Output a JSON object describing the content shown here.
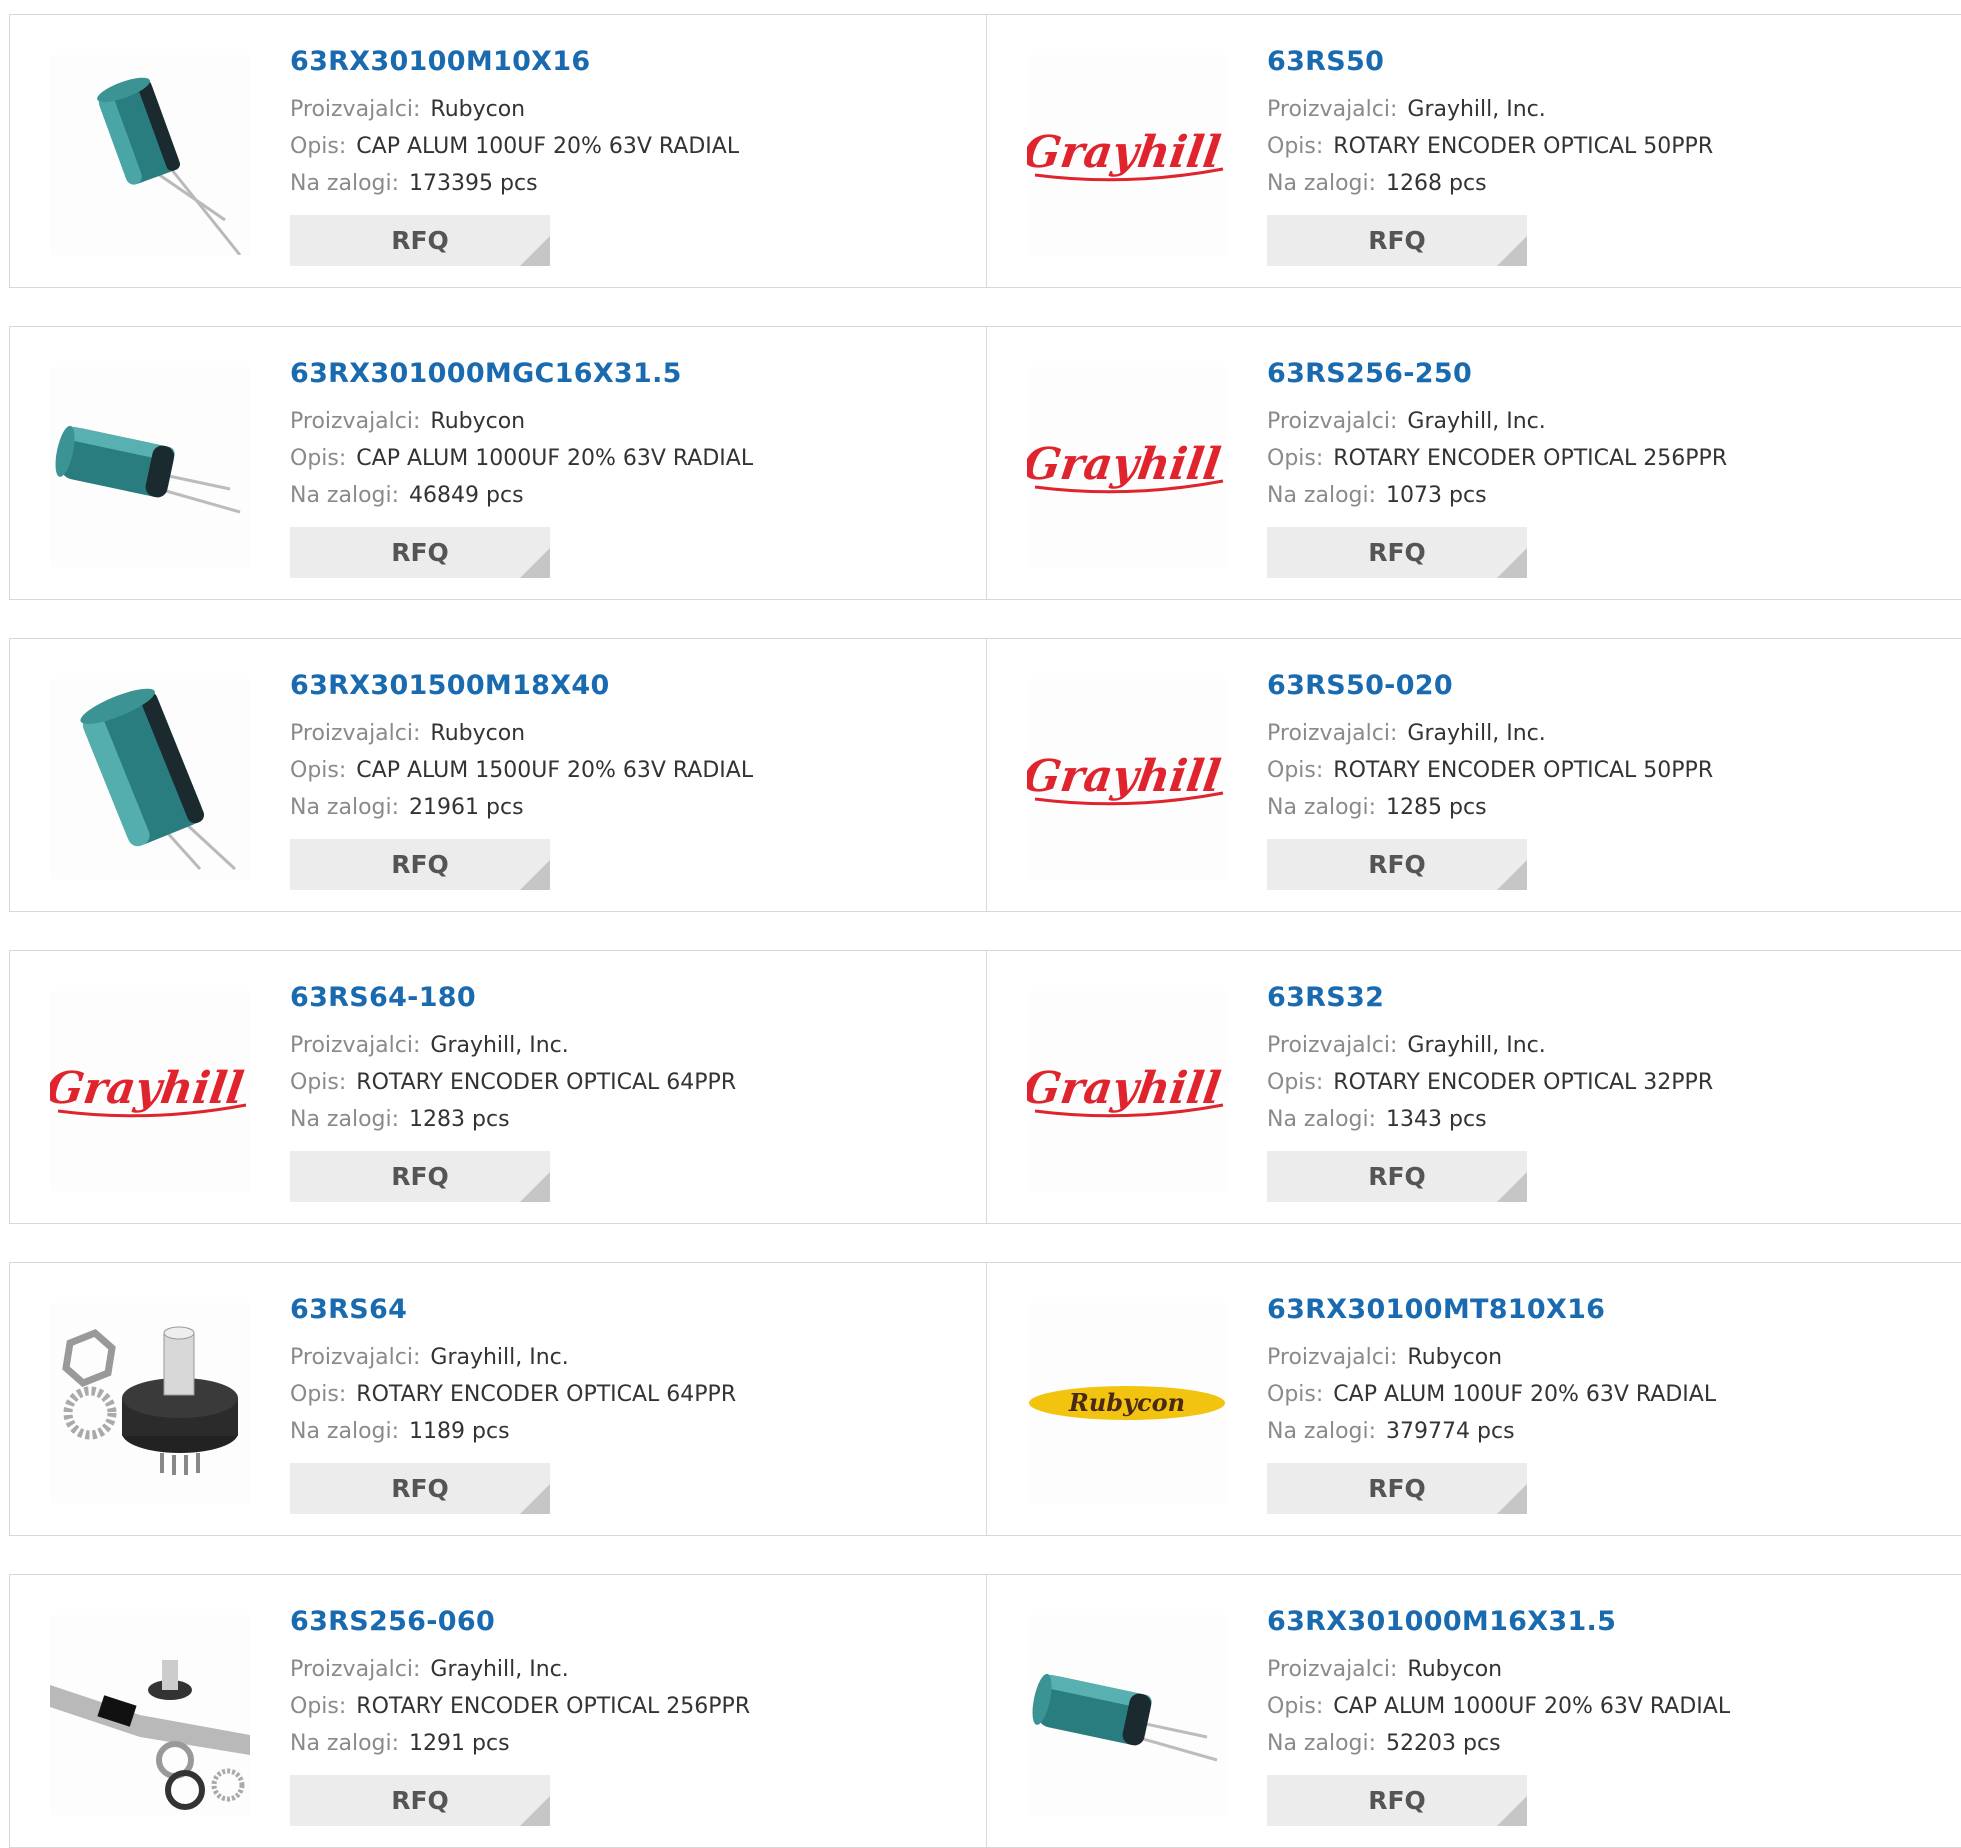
{
  "labels": {
    "manufacturer": "Proizvajalci:",
    "description": "Opis:",
    "stock": "Na zalogi:",
    "rfq": "RFQ"
  },
  "products": [
    {
      "name": "63RX30100M10X16",
      "manufacturer": "Rubycon",
      "description": "CAP ALUM 100UF 20% 63V RADIAL",
      "stock": "173395 pcs",
      "image": "capacitor-small"
    },
    {
      "name": "63RS50",
      "manufacturer": "Grayhill, Inc.",
      "description": "ROTARY ENCODER OPTICAL 50PPR",
      "stock": "1268 pcs",
      "image": "grayhill-logo",
      "logo_text": "Grayhill"
    },
    {
      "name": "63RX301000MGC16X31.5",
      "manufacturer": "Rubycon",
      "description": "CAP ALUM 1000UF 20% 63V RADIAL",
      "stock": "46849 pcs",
      "image": "capacitor-side"
    },
    {
      "name": "63RS256-250",
      "manufacturer": "Grayhill, Inc.",
      "description": "ROTARY ENCODER OPTICAL 256PPR",
      "stock": "1073 pcs",
      "image": "grayhill-logo",
      "logo_text": "Grayhill"
    },
    {
      "name": "63RX301500M18X40",
      "manufacturer": "Rubycon",
      "description": "CAP ALUM 1500UF 20% 63V RADIAL",
      "stock": "21961 pcs",
      "image": "capacitor-large"
    },
    {
      "name": "63RS50-020",
      "manufacturer": "Grayhill, Inc.",
      "description": "ROTARY ENCODER OPTICAL 50PPR",
      "stock": "1285 pcs",
      "image": "grayhill-logo",
      "logo_text": "Grayhill"
    },
    {
      "name": "63RS64-180",
      "manufacturer": "Grayhill, Inc.",
      "description": "ROTARY ENCODER OPTICAL 64PPR",
      "stock": "1283 pcs",
      "image": "grayhill-logo",
      "logo_text": "Grayhill"
    },
    {
      "name": "63RS32",
      "manufacturer": "Grayhill, Inc.",
      "description": "ROTARY ENCODER OPTICAL 32PPR",
      "stock": "1343 pcs",
      "image": "grayhill-logo",
      "logo_text": "Grayhill"
    },
    {
      "name": "63RS64",
      "manufacturer": "Grayhill, Inc.",
      "description": "ROTARY ENCODER OPTICAL 64PPR",
      "stock": "1189 pcs",
      "image": "rotary-encoder"
    },
    {
      "name": "63RX30100MT810X16",
      "manufacturer": "Rubycon",
      "description": "CAP ALUM 100UF 20% 63V RADIAL",
      "stock": "379774 pcs",
      "image": "rubycon-logo",
      "logo_text": "Rubycon"
    },
    {
      "name": "63RS256-060",
      "manufacturer": "Grayhill, Inc.",
      "description": "ROTARY ENCODER OPTICAL 256PPR",
      "stock": "1291 pcs",
      "image": "encoder-ribbon"
    },
    {
      "name": "63RX301000M16X31.5",
      "manufacturer": "Rubycon",
      "description": "CAP ALUM 1000UF 20% 63V RADIAL",
      "stock": "52203 pcs",
      "image": "capacitor-side"
    }
  ],
  "colors": {
    "link": "#1a6ab0",
    "label": "#8a8a8a",
    "button_bg": "#ececec",
    "grayhill_red": "#e0242e",
    "rubycon_yellow": "#f2c40f",
    "capacitor_teal": "#2a7d7e"
  }
}
